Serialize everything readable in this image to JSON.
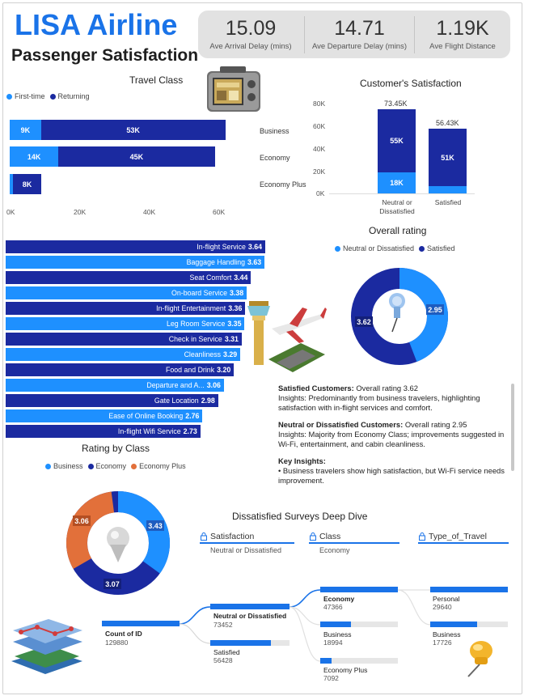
{
  "header": {
    "title": "LISA Airline",
    "subtitle": "Passenger Satisfaction"
  },
  "kpis": [
    {
      "value": "15.09",
      "label": "Ave Arrival Delay (mins)"
    },
    {
      "value": "14.71",
      "label": "Ave Departure Delay (mins)"
    },
    {
      "value": "1.19K",
      "label": "Ave Flight Distance"
    }
  ],
  "colors": {
    "dark": "#1b2aa0",
    "light": "#1e90ff",
    "orange": "#e2703a",
    "accent": "#1a73e8"
  },
  "travel_class": {
    "title": "Travel Class",
    "legend": [
      "First-time",
      "Returning"
    ],
    "rows": [
      {
        "label": "Business",
        "first": "9K",
        "returning": "53K"
      },
      {
        "label": "Economy",
        "first": "14K",
        "returning": "45K"
      },
      {
        "label": "Economy Plus",
        "first": "",
        "returning": "8K"
      }
    ],
    "ticks": [
      "0K",
      "20K",
      "40K",
      "60K"
    ]
  },
  "customer_satisfaction": {
    "title": "Customer's Satisfaction",
    "ticks": [
      "80K",
      "60K",
      "40K",
      "20K",
      "0K"
    ],
    "bars": [
      {
        "label": "Neutral or Dissatisfied",
        "total": "73.45K",
        "top": "55K",
        "bottom": "18K"
      },
      {
        "label": "Satisfied",
        "total": "56.43K",
        "top": "51K",
        "bottom": ""
      }
    ]
  },
  "overall_rating": {
    "title": "Overall rating",
    "legend": [
      "Neutral or Dissatisfied",
      "Satisfied"
    ],
    "values": [
      "2.95",
      "3.62"
    ]
  },
  "services": [
    {
      "name": "In-flight Service",
      "value": "3.64"
    },
    {
      "name": "Baggage Handling",
      "value": "3.63"
    },
    {
      "name": "Seat Comfort",
      "value": "3.44"
    },
    {
      "name": "On-board Service",
      "value": "3.38"
    },
    {
      "name": "In-flight Entertainment",
      "value": "3.36"
    },
    {
      "name": "Leg Room Service",
      "value": "3.35"
    },
    {
      "name": "Check in Service",
      "value": "3.31"
    },
    {
      "name": "Cleanliness",
      "value": "3.29"
    },
    {
      "name": "Food and Drink",
      "value": "3.20"
    },
    {
      "name": "Departure and A...",
      "value": "3.06"
    },
    {
      "name": "Gate Location",
      "value": "2.98"
    },
    {
      "name": "Ease of Online Booking",
      "value": "2.76"
    },
    {
      "name": "In-flight Wifi Service",
      "value": "2.73"
    }
  ],
  "insights": {
    "satisfied_head": "Satisfied Customers:",
    "satisfied_text": " Overall rating 3.62",
    "satisfied_insight": "Insights: Predominantly from business travelers, highlighting satisfaction with in-flight services and comfort.",
    "neutral_head": "Neutral or Dissatisfied Customers:",
    "neutral_text": " Overall rating 2.95",
    "neutral_insight": "Insights: Majority from Economy Class; improvements suggested in Wi-Fi, entertainment, and cabin cleanliness.",
    "key_head": "Key Insights:",
    "key_bullet": "• Business travelers show high satisfaction, but Wi-Fi service needs improvement."
  },
  "rating_by_class": {
    "title": "Rating by Class",
    "legend": [
      "Business",
      "Economy",
      "Economy Plus"
    ],
    "values": [
      "3.43",
      "3.07",
      "3.06"
    ]
  },
  "deep_dive": {
    "title": "Dissatisfied Surveys Deep Dive",
    "filters": [
      {
        "name": "Satisfaction",
        "value": "Neutral or Dissatisfied"
      },
      {
        "name": "Class",
        "value": "Economy"
      },
      {
        "name": "Type_of_Travel",
        "value": ""
      }
    ],
    "root": {
      "name": "Count of ID",
      "value": "129880"
    },
    "level1": [
      {
        "name": "Neutral or Dissatisfied",
        "value": "73452"
      },
      {
        "name": "Satisfied",
        "value": "56428"
      }
    ],
    "level2": [
      {
        "name": "Economy",
        "value": "47366"
      },
      {
        "name": "Business",
        "value": "18994"
      },
      {
        "name": "Economy Plus",
        "value": "7092"
      }
    ],
    "level3": [
      {
        "name": "Personal",
        "value": "29640"
      },
      {
        "name": "Business",
        "value": "17726"
      }
    ]
  }
}
